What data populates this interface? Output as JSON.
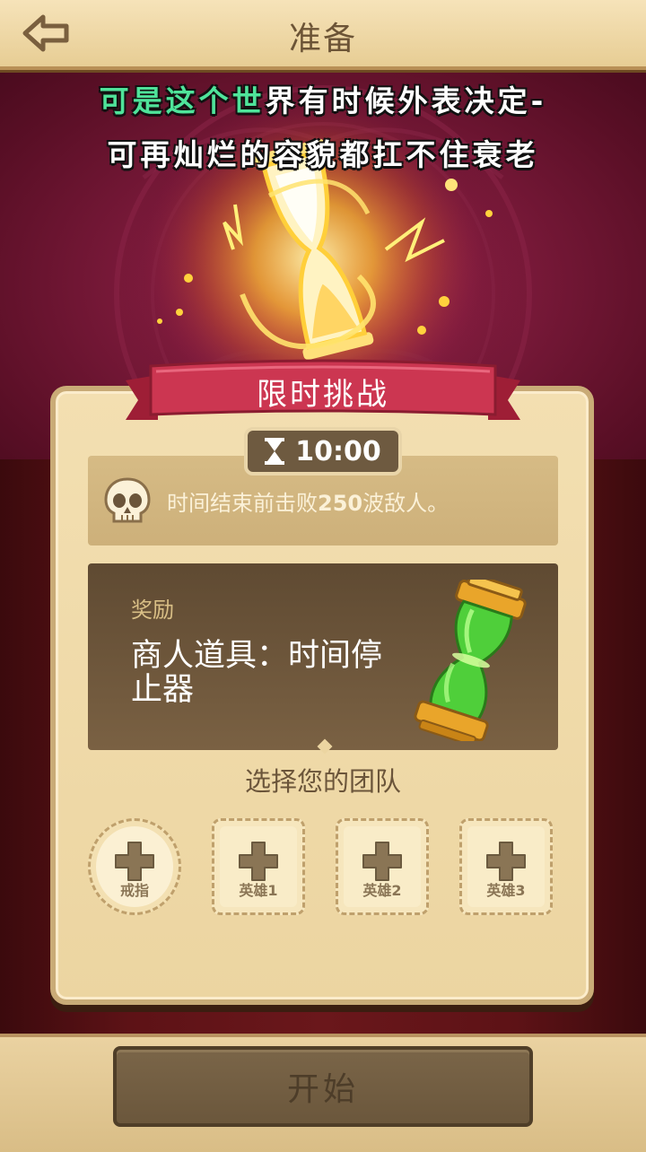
{
  "header": {
    "title": "准备",
    "back_icon": "back-arrow-icon"
  },
  "caption": {
    "line1_highlight": "可是这个世",
    "line1_rest": "界有时候外表决定-",
    "line2": "可再灿烂的容貌都扛不住衰老"
  },
  "challenge": {
    "title": "限时挑战",
    "timer": "10:00",
    "timer_icon": "hourglass-icon",
    "objective_prefix": "时间结束前击败",
    "objective_count": "250",
    "objective_suffix": "波敌人。",
    "objective_icon": "skull-icon"
  },
  "reward": {
    "label": "奖励",
    "name": "商人道具：时间停止器",
    "item_icon": "time-stopper-icon"
  },
  "team": {
    "title": "选择您的团队",
    "slots": [
      {
        "label": "戒指",
        "icon": "plus-icon"
      },
      {
        "label": "英雄1",
        "icon": "plus-icon"
      },
      {
        "label": "英雄2",
        "icon": "plus-icon"
      },
      {
        "label": "英雄3",
        "icon": "plus-icon"
      }
    ]
  },
  "start_button": {
    "label": "开始"
  },
  "colors": {
    "hero_bg": "#7c1a3b",
    "ribbon": "#c8324a",
    "card": "#f0dba8",
    "reward_bg": "#6a5438",
    "caption_highlight": "#4fe39a",
    "start_button": "#6f5a3f"
  }
}
